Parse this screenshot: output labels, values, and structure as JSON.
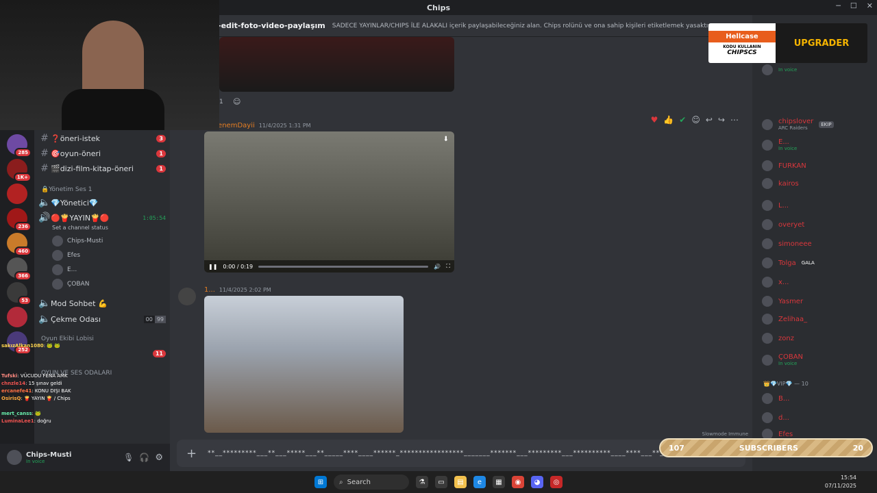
{
  "window": {
    "title": "Chips"
  },
  "topbar": {
    "channel": "-edit-foto-video-paylaşım",
    "topic": "SADECE YAYINLAR/CHIPS İLE ALAKALI içerik paylaşabileceğiniz alan. Chips rolünü ve ona sahip kişileri etiketlemek yasaktır."
  },
  "servers": [
    {
      "badge": "285"
    },
    {
      "badge": "1K+"
    },
    {
      "badge": ""
    },
    {
      "badge": "236"
    },
    {
      "badge": "460"
    },
    {
      "badge": "366"
    },
    {
      "badge": "53"
    },
    {
      "badge": ""
    },
    {
      "badge": "252"
    }
  ],
  "channels": {
    "items": [
      {
        "name": "❓öneri-istek",
        "badge": "3"
      },
      {
        "name": "🎯oyun-öneri",
        "badge": "1"
      },
      {
        "name": "🎬dizi-film-kitap-öneri",
        "badge": "1"
      }
    ],
    "cat1": "🔒Yönetim Ses 1",
    "v1": "💎Yönetici💎",
    "v2": "🔴🍟YAYIN🍟🔴",
    "v2time": "1:05:54",
    "status": "Set a channel status",
    "voiceUsers": [
      "Chips-Musti",
      "Efes",
      "E...",
      "ÇOBAN"
    ],
    "v3": "Mod Sohbet 💪",
    "v4": "Çekme Odası",
    "v4a": "00",
    "v4b": "99",
    "cat2": "Oyun Ekibi Lobisi",
    "cat3": "OYUN VE SES ODALARI",
    "badge11": "11"
  },
  "user": {
    "name": "Chips-Musti",
    "status": "In voice"
  },
  "messages": [
    {
      "author": "KenemDayii",
      "time": "11/4/2025 1:31 PM",
      "video_time": "0:00 / 0:19"
    },
    {
      "author": "1...",
      "time": "11/4/2025 2:02 PM"
    }
  ],
  "reaction_count": "1",
  "composer": {
    "text": "**__*********___**___*****___**_____****____******_*****************_______*******___*********___**********____****___**___*****"
  },
  "slowmode": "Slowmode Immune",
  "members": [
    {
      "name": "In voice",
      "sub": ""
    },
    {
      "name": "chipslover",
      "sub": "ARC Raiders",
      "tag": "EKIP"
    },
    {
      "name": "E...",
      "sub": "In voice"
    },
    {
      "name": "FURKAN",
      "sub": ""
    },
    {
      "name": "kairos",
      "sub": ""
    },
    {
      "name": "L...",
      "sub": ""
    },
    {
      "name": "overyet",
      "sub": ""
    },
    {
      "name": "simoneee",
      "sub": ""
    },
    {
      "name": "Tolga",
      "sub": "",
      "tag": "GALA"
    },
    {
      "name": "x...",
      "sub": ""
    },
    {
      "name": "Yasmer",
      "sub": ""
    },
    {
      "name": "Zelihaa_",
      "sub": ""
    },
    {
      "name": "zonz",
      "sub": ""
    },
    {
      "name": "ÇOBAN",
      "sub": "In voice"
    }
  ],
  "vip_header": "👑💎VIP💎 — 10",
  "vip": [
    "B...",
    "d...",
    "Efes"
  ],
  "banner": {
    "brand": "Hellcase",
    "line1": "KODU KULLANIN",
    "code": "CHIPSCS",
    "right": "UPGRADER"
  },
  "subs": {
    "left": "107",
    "label": "SUBSCRIBERS",
    "right": "20"
  },
  "chat": [
    {
      "u": "sakızAlkan1080",
      "m": ": 🐸 🐸"
    },
    {
      "u": "Tufski",
      "m": ": VÜCUDU FENA AMK"
    },
    {
      "u": "chnzle14",
      "m": ": 15 şınav geldi"
    },
    {
      "u": "ercanefe41",
      "m": ": KONU DIŞI BAK"
    },
    {
      "u": "OsirisQ",
      "m": ": 🍟 YAYIN 🍟 / Chips"
    },
    {
      "u": "mert_canss",
      "m": ": 🐸"
    },
    {
      "u": "LuminaLee1",
      "m": ": doğru"
    }
  ],
  "taskbar": {
    "search": "Search",
    "time": "15:54",
    "date": "07/11/2025"
  },
  "icons": [
    "hash-icon",
    "speaker-icon",
    "search-icon",
    "gear-icon",
    "mic-icon",
    "headphones-icon",
    "plus-icon"
  ]
}
